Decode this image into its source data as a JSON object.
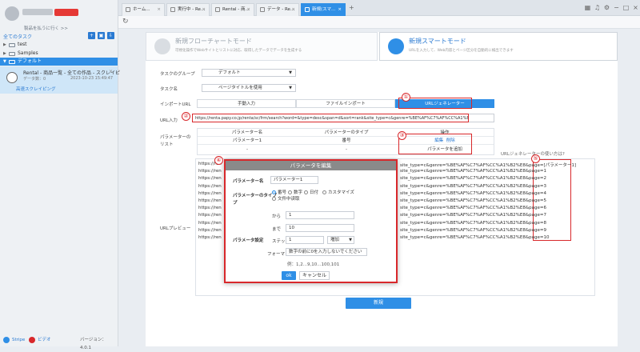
{
  "sidebar": {
    "goto_label": "製品を払うに行く >>",
    "header": "全てのタスク",
    "tree": [
      {
        "label": "test",
        "expanded": false
      },
      {
        "label": "Samples",
        "expanded": false
      },
      {
        "label": "デフォルト",
        "expanded": true
      }
    ],
    "task": {
      "title": "Rental - 商品一覧 - 全ての作品 - スクレイピ",
      "meta_label": "データ数：",
      "meta_value": "0",
      "date": "2023-10-23 15:49:47",
      "scrape_label": "高速スクレイピング"
    },
    "footer": {
      "app": "Stripe",
      "video": "ビデオ",
      "version": "バージョン：4.0.1"
    }
  },
  "tabs": [
    {
      "label": "ホーム..."
    },
    {
      "label": "実行中 - Re..."
    },
    {
      "label": "Rental - 商..."
    },
    {
      "label": "データ - Re..."
    },
    {
      "label": "新規(スマ..."
    }
  ],
  "modes": {
    "flow_title": "新規フローチャートモード",
    "flow_sub": "可視化操作でWebサイトとリストに対応、取得したデータでデータを生成する",
    "smart_title": "新規スマートモード",
    "smart_sub": "URLを入力して、Web内容とページ区分を自動的に検出できます"
  },
  "form": {
    "group_label": "タスクのグループ",
    "group_value": "デフォルト",
    "name_label": "タスク名",
    "name_value": "ページタイトルを使用",
    "import_label": "インポートURL",
    "import_tabs": [
      "手動入力",
      "ファイルインポート",
      "URLジェネレーター"
    ],
    "url_label": "URL入力",
    "url_value": "https://renta.papy.co.jp/renta/sc/frm/search?word=&type=desc&span=d&sort=rank&site_type=c&genre=%BE%AF%C7%AF%CC%A1%B2%E8&page=",
    "param_list_label": "パラメーターのリスト",
    "param_headers": [
      "パラメーター名",
      "パラメーターのタイプ",
      "操作"
    ],
    "param_row": {
      "name": "パラメーター1",
      "type": "番号",
      "edit": "編集",
      "delete": "削除"
    },
    "param_dash": "-",
    "add_param": "パラメータを追加",
    "usage_link": "URLジェネレーターの使い方は?",
    "preview_label": "URLプレビュー",
    "create_button": "新規"
  },
  "preview": {
    "prefix": "https://ren",
    "suffix_lines": [
      "site_type=c&genre=%BE%AF%C7%AF%CC%A1%B2%E8&page=[パラメーター1]",
      "site_type=c&genre=%BE%AF%C7%AF%CC%A1%B2%E8&page=1",
      "site_type=c&genre=%BE%AF%C7%AF%CC%A1%B2%E8&page=2",
      "site_type=c&genre=%BE%AF%C7%AF%CC%A1%B2%E8&page=3",
      "site_type=c&genre=%BE%AF%C7%AF%CC%A1%B2%E8&page=4",
      "site_type=c&genre=%BE%AF%C7%AF%CC%A1%B2%E8&page=5",
      "site_type=c&genre=%BE%AF%C7%AF%CC%A1%B2%E8&page=6",
      "site_type=c&genre=%BE%AF%C7%AF%CC%A1%B2%E8&page=7",
      "site_type=c&genre=%BE%AF%C7%AF%CC%A1%B2%E8&page=8",
      "site_type=c&genre=%BE%AF%C7%AF%CC%A1%B2%E8&page=9",
      "site_type=c&genre=%BE%AF%C7%AF%CC%A1%B2%E8&page=10"
    ]
  },
  "dialog": {
    "title": "パラメータを編集",
    "name_label": "パラメーター名",
    "name_value": "パラメーター1",
    "type_label": "パラメーターのタイプ",
    "type_options": [
      "番号",
      "数字",
      "日付",
      "カスタマイズ",
      "文件中读取"
    ],
    "type_selected": 0,
    "settings_label": "パラメータ設定",
    "from_label": "から",
    "from_value": "1",
    "to_label": "まで",
    "to_value": "10",
    "step_label": "ステップ",
    "step_value": "1",
    "step_mode": "増加",
    "format_label": "フォーマット",
    "format_value": "数字の前に0を入力しないでください",
    "example": "例：1,2...9,10...100,101",
    "ok": "ok",
    "cancel": "キャンセル"
  },
  "annotations": [
    "①",
    "②",
    "③",
    "④",
    "⑤"
  ],
  "colors": {
    "accent": "#2f8fe6",
    "annotation": "#d8282b"
  }
}
